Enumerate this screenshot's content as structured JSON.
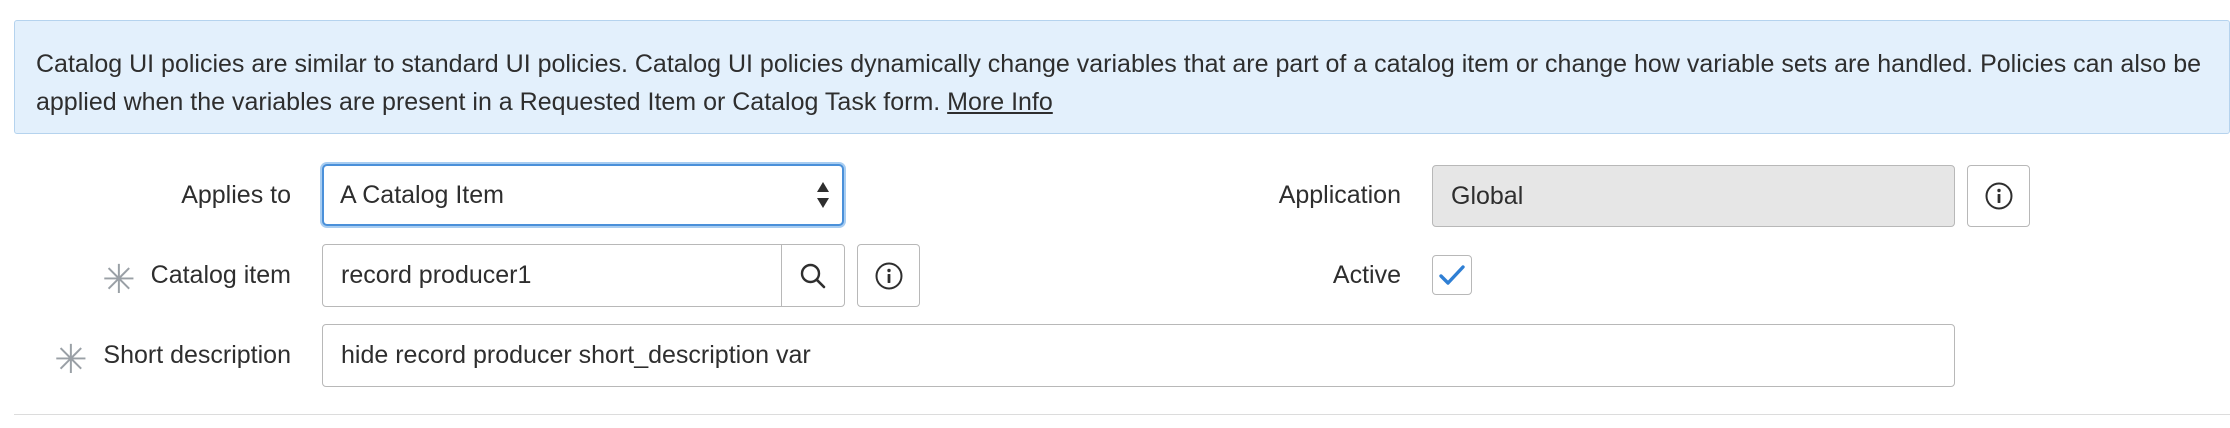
{
  "banner": {
    "text": "Catalog UI policies are similar to standard UI policies. Catalog UI policies dynamically change variables that are part of a catalog item or change how variable sets are handled. Policies can also be applied when the variables are present in a Requested Item or Catalog Task form.",
    "link_label": "More Info"
  },
  "form": {
    "applies_to": {
      "label": "Applies to",
      "value": "A Catalog Item"
    },
    "application": {
      "label": "Application",
      "value": "Global",
      "info_icon": "info-icon"
    },
    "catalog_item": {
      "required_marker": "✳",
      "label": "Catalog item",
      "value": "record producer1",
      "search_icon": "search-icon",
      "info_icon": "info-icon"
    },
    "active": {
      "label": "Active",
      "checked": true,
      "check_icon": "checkmark-icon"
    },
    "short_description": {
      "required_marker": "✳",
      "label": "Short description",
      "value": "hide record producer short_description var"
    }
  },
  "colors": {
    "banner_bg": "#e3f0fc",
    "banner_border": "#b5d3ee",
    "focus_border": "#4a90d9",
    "checkmark": "#2f7fd4",
    "readonly_bg": "#e6e6e6",
    "required_marker": "#9aa0a6"
  }
}
